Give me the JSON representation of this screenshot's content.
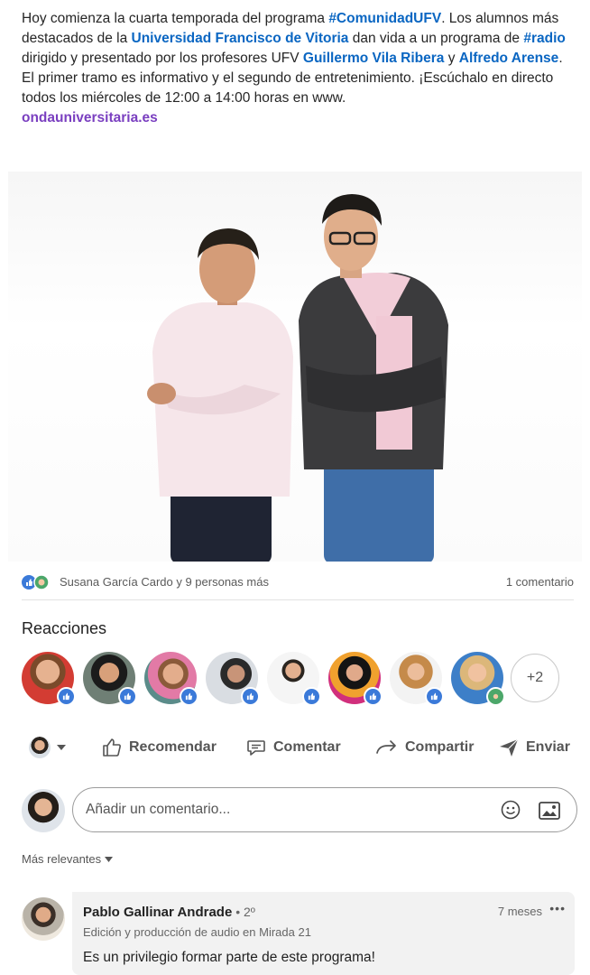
{
  "post": {
    "t1": "Hoy comienza la cuarta temporada del programa ",
    "hashtag_comunidad": "#ComunidadUFV",
    "t2": ". Los alumnos más destacados de la ",
    "mention_ufv": "Universidad Francisco de Vitoria",
    "t3": " dan vida a un programa de ",
    "hashtag_radio": "#radio",
    "t4": " dirigido y presentado por los profesores UFV ",
    "mention_guillermo": "Guillermo Vila Ribera",
    "t5": " y ",
    "mention_alfredo": "Alfredo Arense",
    "t6": ".",
    "t7": "El primer tramo es informativo y el segundo de entretenimiento. ¡Escúchalo en directo todos los miércoles de 12:00 a 14:00 horas en www.",
    "link": "ondauniversitaria.es"
  },
  "social": {
    "reactors_text": "Susana García Cardo y 9 personas más",
    "comments_count": "1 comentario"
  },
  "reactions": {
    "title": "Reacciones",
    "more_label": "+2"
  },
  "actions": {
    "recommend": "Recomendar",
    "comment": "Comentar",
    "share": "Compartir",
    "send": "Enviar"
  },
  "comment_input": {
    "placeholder": "Añadir un comentario..."
  },
  "sort": {
    "label": "Más relevantes"
  },
  "comment": {
    "author": "Pablo Gallinar Andrade",
    "degree": " • 2º",
    "headline": "Edición y producción de audio en Mirada 21",
    "time": "7 meses",
    "more": "•••",
    "text": "Es un privilegio formar parte de este programa!"
  },
  "colors": {
    "link_blue": "#0a66c2",
    "link_purple": "#7a3fc0",
    "like_badge": "#3b7ad9",
    "support_badge": "#4ca76a"
  },
  "icons": {
    "recommend": "thumb-up-outline-icon",
    "comment": "speech-bubble-icon",
    "share": "share-arrow-icon",
    "send": "paper-plane-icon",
    "emoji": "smiley-icon",
    "image": "image-icon",
    "caret": "caret-down-icon"
  }
}
